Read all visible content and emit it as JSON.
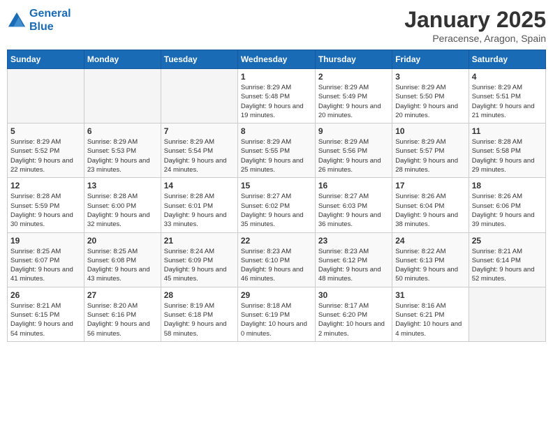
{
  "logo": {
    "line1": "General",
    "line2": "Blue"
  },
  "title": "January 2025",
  "subtitle": "Peracense, Aragon, Spain",
  "weekdays": [
    "Sunday",
    "Monday",
    "Tuesday",
    "Wednesday",
    "Thursday",
    "Friday",
    "Saturday"
  ],
  "weeks": [
    [
      {
        "day": "",
        "sunrise": "",
        "sunset": "",
        "daylight": ""
      },
      {
        "day": "",
        "sunrise": "",
        "sunset": "",
        "daylight": ""
      },
      {
        "day": "",
        "sunrise": "",
        "sunset": "",
        "daylight": ""
      },
      {
        "day": "1",
        "sunrise": "Sunrise: 8:29 AM",
        "sunset": "Sunset: 5:48 PM",
        "daylight": "Daylight: 9 hours and 19 minutes."
      },
      {
        "day": "2",
        "sunrise": "Sunrise: 8:29 AM",
        "sunset": "Sunset: 5:49 PM",
        "daylight": "Daylight: 9 hours and 20 minutes."
      },
      {
        "day": "3",
        "sunrise": "Sunrise: 8:29 AM",
        "sunset": "Sunset: 5:50 PM",
        "daylight": "Daylight: 9 hours and 20 minutes."
      },
      {
        "day": "4",
        "sunrise": "Sunrise: 8:29 AM",
        "sunset": "Sunset: 5:51 PM",
        "daylight": "Daylight: 9 hours and 21 minutes."
      }
    ],
    [
      {
        "day": "5",
        "sunrise": "Sunrise: 8:29 AM",
        "sunset": "Sunset: 5:52 PM",
        "daylight": "Daylight: 9 hours and 22 minutes."
      },
      {
        "day": "6",
        "sunrise": "Sunrise: 8:29 AM",
        "sunset": "Sunset: 5:53 PM",
        "daylight": "Daylight: 9 hours and 23 minutes."
      },
      {
        "day": "7",
        "sunrise": "Sunrise: 8:29 AM",
        "sunset": "Sunset: 5:54 PM",
        "daylight": "Daylight: 9 hours and 24 minutes."
      },
      {
        "day": "8",
        "sunrise": "Sunrise: 8:29 AM",
        "sunset": "Sunset: 5:55 PM",
        "daylight": "Daylight: 9 hours and 25 minutes."
      },
      {
        "day": "9",
        "sunrise": "Sunrise: 8:29 AM",
        "sunset": "Sunset: 5:56 PM",
        "daylight": "Daylight: 9 hours and 26 minutes."
      },
      {
        "day": "10",
        "sunrise": "Sunrise: 8:29 AM",
        "sunset": "Sunset: 5:57 PM",
        "daylight": "Daylight: 9 hours and 28 minutes."
      },
      {
        "day": "11",
        "sunrise": "Sunrise: 8:28 AM",
        "sunset": "Sunset: 5:58 PM",
        "daylight": "Daylight: 9 hours and 29 minutes."
      }
    ],
    [
      {
        "day": "12",
        "sunrise": "Sunrise: 8:28 AM",
        "sunset": "Sunset: 5:59 PM",
        "daylight": "Daylight: 9 hours and 30 minutes."
      },
      {
        "day": "13",
        "sunrise": "Sunrise: 8:28 AM",
        "sunset": "Sunset: 6:00 PM",
        "daylight": "Daylight: 9 hours and 32 minutes."
      },
      {
        "day": "14",
        "sunrise": "Sunrise: 8:28 AM",
        "sunset": "Sunset: 6:01 PM",
        "daylight": "Daylight: 9 hours and 33 minutes."
      },
      {
        "day": "15",
        "sunrise": "Sunrise: 8:27 AM",
        "sunset": "Sunset: 6:02 PM",
        "daylight": "Daylight: 9 hours and 35 minutes."
      },
      {
        "day": "16",
        "sunrise": "Sunrise: 8:27 AM",
        "sunset": "Sunset: 6:03 PM",
        "daylight": "Daylight: 9 hours and 36 minutes."
      },
      {
        "day": "17",
        "sunrise": "Sunrise: 8:26 AM",
        "sunset": "Sunset: 6:04 PM",
        "daylight": "Daylight: 9 hours and 38 minutes."
      },
      {
        "day": "18",
        "sunrise": "Sunrise: 8:26 AM",
        "sunset": "Sunset: 6:06 PM",
        "daylight": "Daylight: 9 hours and 39 minutes."
      }
    ],
    [
      {
        "day": "19",
        "sunrise": "Sunrise: 8:25 AM",
        "sunset": "Sunset: 6:07 PM",
        "daylight": "Daylight: 9 hours and 41 minutes."
      },
      {
        "day": "20",
        "sunrise": "Sunrise: 8:25 AM",
        "sunset": "Sunset: 6:08 PM",
        "daylight": "Daylight: 9 hours and 43 minutes."
      },
      {
        "day": "21",
        "sunrise": "Sunrise: 8:24 AM",
        "sunset": "Sunset: 6:09 PM",
        "daylight": "Daylight: 9 hours and 45 minutes."
      },
      {
        "day": "22",
        "sunrise": "Sunrise: 8:23 AM",
        "sunset": "Sunset: 6:10 PM",
        "daylight": "Daylight: 9 hours and 46 minutes."
      },
      {
        "day": "23",
        "sunrise": "Sunrise: 8:23 AM",
        "sunset": "Sunset: 6:12 PM",
        "daylight": "Daylight: 9 hours and 48 minutes."
      },
      {
        "day": "24",
        "sunrise": "Sunrise: 8:22 AM",
        "sunset": "Sunset: 6:13 PM",
        "daylight": "Daylight: 9 hours and 50 minutes."
      },
      {
        "day": "25",
        "sunrise": "Sunrise: 8:21 AM",
        "sunset": "Sunset: 6:14 PM",
        "daylight": "Daylight: 9 hours and 52 minutes."
      }
    ],
    [
      {
        "day": "26",
        "sunrise": "Sunrise: 8:21 AM",
        "sunset": "Sunset: 6:15 PM",
        "daylight": "Daylight: 9 hours and 54 minutes."
      },
      {
        "day": "27",
        "sunrise": "Sunrise: 8:20 AM",
        "sunset": "Sunset: 6:16 PM",
        "daylight": "Daylight: 9 hours and 56 minutes."
      },
      {
        "day": "28",
        "sunrise": "Sunrise: 8:19 AM",
        "sunset": "Sunset: 6:18 PM",
        "daylight": "Daylight: 9 hours and 58 minutes."
      },
      {
        "day": "29",
        "sunrise": "Sunrise: 8:18 AM",
        "sunset": "Sunset: 6:19 PM",
        "daylight": "Daylight: 10 hours and 0 minutes."
      },
      {
        "day": "30",
        "sunrise": "Sunrise: 8:17 AM",
        "sunset": "Sunset: 6:20 PM",
        "daylight": "Daylight: 10 hours and 2 minutes."
      },
      {
        "day": "31",
        "sunrise": "Sunrise: 8:16 AM",
        "sunset": "Sunset: 6:21 PM",
        "daylight": "Daylight: 10 hours and 4 minutes."
      },
      {
        "day": "",
        "sunrise": "",
        "sunset": "",
        "daylight": ""
      }
    ]
  ]
}
